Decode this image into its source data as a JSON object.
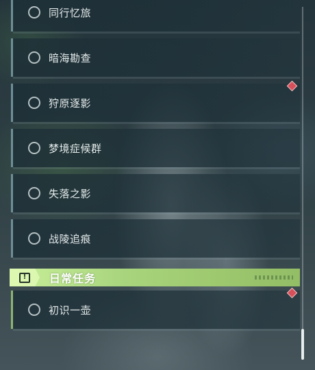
{
  "quests": [
    {
      "label": "同行忆旅"
    },
    {
      "label": "暗海勘查"
    },
    {
      "label": "狩原逐影"
    },
    {
      "label": "梦境症候群"
    },
    {
      "label": "失落之影"
    },
    {
      "label": "战陵追痕"
    }
  ],
  "daily_section": {
    "title": "日常任务",
    "icon": "task-alert-icon"
  },
  "daily_quests": [
    {
      "label": "初识一壶"
    }
  ],
  "colors": {
    "accent_green": "#a8d47d",
    "badge_red": "#d6505a"
  }
}
